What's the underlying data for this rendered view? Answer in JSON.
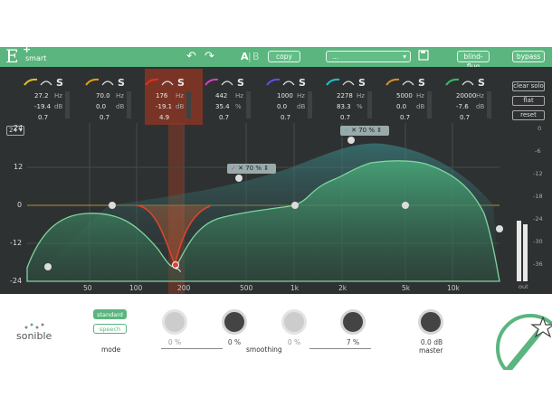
{
  "app": {
    "logo_mark": "E",
    "logo_word": "smart"
  },
  "toolbar": {
    "undo_icon": "undo-icon",
    "redo_icon": "redo-icon",
    "ab_label_a": "A",
    "ab_label_b": "B",
    "copy_label": "copy",
    "preset_placeholder": "...",
    "save_icon": "save-icon",
    "blindflug_label": "blind-flug",
    "bypass_label": "bypass"
  },
  "bands": [
    {
      "color": "#e0c020",
      "freq": "27.2",
      "freq_unit": "Hz",
      "gain": "-19.4",
      "gain_unit": "dB",
      "q": "0.7",
      "solo": "S"
    },
    {
      "color": "#e0a010",
      "freq": "70.0",
      "freq_unit": "Hz",
      "gain": "0.0",
      "gain_unit": "dB",
      "q": "0.7",
      "solo": "S"
    },
    {
      "color": "#e03020",
      "freq": "176",
      "freq_unit": "Hz",
      "gain": "-19.1",
      "gain_unit": "dB",
      "q": "4.9",
      "solo": "S"
    },
    {
      "color": "#d040c0",
      "freq": "442",
      "freq_unit": "Hz",
      "gain": "35.4",
      "gain_unit": "%",
      "q": "0.7",
      "solo": "S"
    },
    {
      "color": "#6050e0",
      "freq": "1000",
      "freq_unit": "Hz",
      "gain": "0.0",
      "gain_unit": "dB",
      "q": "0.7",
      "solo": "S"
    },
    {
      "color": "#20c0d0",
      "freq": "2278",
      "freq_unit": "Hz",
      "gain": "83.3",
      "gain_unit": "%",
      "q": "0.7",
      "solo": "S"
    },
    {
      "color": "#d09030",
      "freq": "5000",
      "freq_unit": "Hz",
      "gain": "0.0",
      "gain_unit": "dB",
      "q": "0.7",
      "solo": "S"
    },
    {
      "color": "#30c060",
      "freq": "20000",
      "freq_unit": "Hz",
      "gain": "-7.6",
      "gain_unit": "dB",
      "q": "0.7",
      "solo": "S"
    }
  ],
  "side": {
    "clear_solo": "clear solo",
    "flat": "flat",
    "reset": "reset",
    "out_label": "out"
  },
  "graph": {
    "range_select": "24",
    "y_labels": [
      "24",
      "12",
      "0",
      "-12",
      "-24"
    ],
    "right_labels": [
      "0",
      "-6",
      "-12",
      "-18",
      "-24",
      "-30",
      "-36"
    ],
    "x_labels": [
      "50",
      "100",
      "200",
      "500",
      "1k",
      "2k",
      "5k",
      "10k"
    ],
    "popup1": {
      "value": "70 %"
    },
    "popup2": {
      "value": "70 %"
    }
  },
  "footer": {
    "brand": "sonible",
    "mode_standard": "standard",
    "mode_speech": "speech",
    "mode_label": "mode",
    "knobs": [
      {
        "value": "0 %",
        "active": false
      },
      {
        "value": "0 %",
        "active": true
      },
      {
        "value": "0 %",
        "active": false
      },
      {
        "value": "7 %",
        "active": true
      },
      {
        "value": "0.0 dB",
        "active": true
      }
    ],
    "smoothing_label": "smoothing",
    "master_label": "master"
  }
}
